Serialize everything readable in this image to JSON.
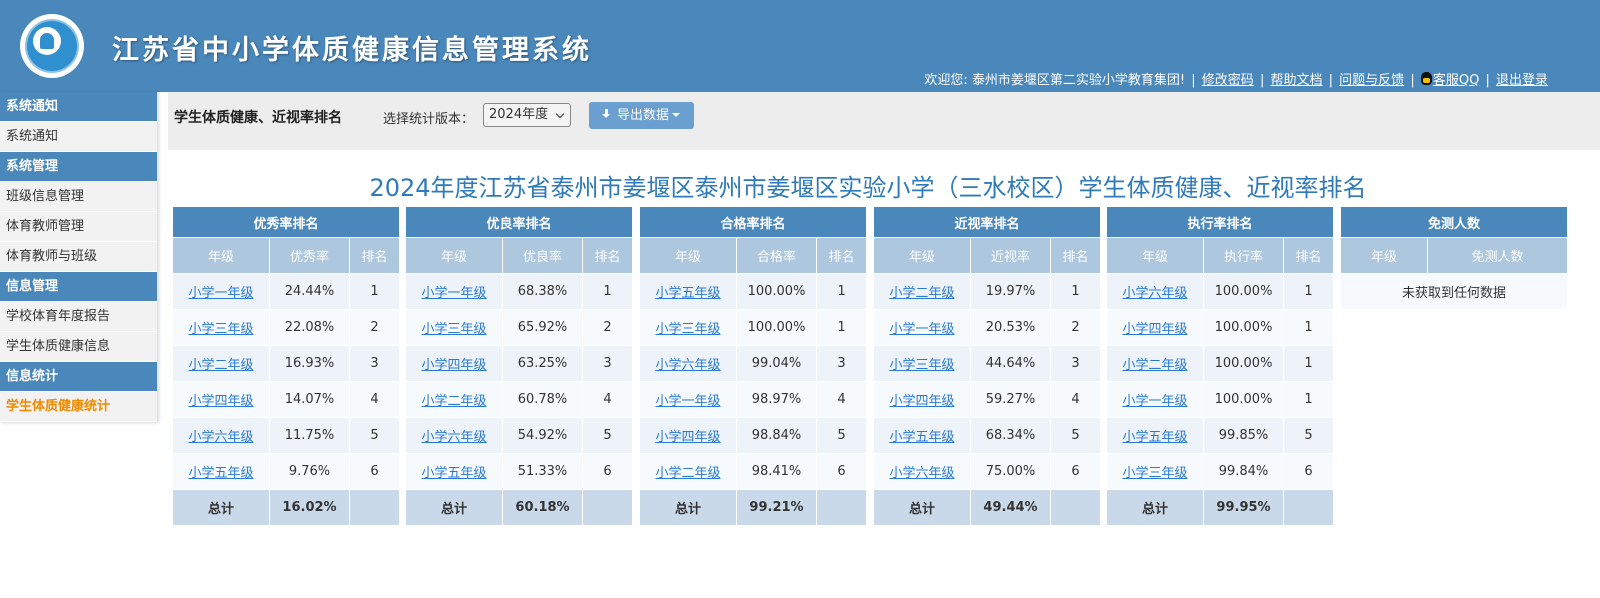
{
  "header": {
    "system_title": "江苏省中小学体质健康信息管理系统",
    "welcome": "欢迎您: 泰州市姜堰区第二实验小学教育集团!",
    "links": {
      "change_password": "修改密码",
      "help": "帮助文档",
      "feedback": "问题与反馈",
      "qq_service": "客服QQ",
      "logout": "退出登录"
    }
  },
  "sidebar": [
    {
      "category": "系统通知",
      "items": [
        {
          "label": "系统通知",
          "active": false
        }
      ]
    },
    {
      "category": "系统管理",
      "items": [
        {
          "label": "班级信息管理",
          "active": false
        },
        {
          "label": "体育教师管理",
          "active": false
        },
        {
          "label": "体育教师与班级",
          "active": false
        }
      ]
    },
    {
      "category": "信息管理",
      "items": [
        {
          "label": "学校体育年度报告",
          "active": false
        },
        {
          "label": "学生体质健康信息",
          "active": false
        }
      ]
    },
    {
      "category": "信息统计",
      "items": [
        {
          "label": "学生体质健康统计",
          "active": true
        }
      ]
    }
  ],
  "toolbar": {
    "title": "学生体质健康、近视率排名",
    "version_label": "选择统计版本：",
    "version_value": "2024年度",
    "export_label": "导出数据"
  },
  "report_title": "2024年度江苏省泰州市姜堰区泰州市姜堰区实验小学（三水校区）学生体质健康、近视率排名",
  "tables": [
    {
      "caption": "优秀率排名",
      "headers": [
        "年级",
        "优秀率",
        "排名"
      ],
      "rows": [
        [
          "小学一年级",
          "24.44%",
          "1"
        ],
        [
          "小学三年级",
          "22.08%",
          "2"
        ],
        [
          "小学二年级",
          "16.93%",
          "3"
        ],
        [
          "小学四年级",
          "14.07%",
          "4"
        ],
        [
          "小学六年级",
          "11.75%",
          "5"
        ],
        [
          "小学五年级",
          "9.76%",
          "6"
        ]
      ],
      "total": [
        "总计",
        "16.02%",
        ""
      ]
    },
    {
      "caption": "优良率排名",
      "headers": [
        "年级",
        "优良率",
        "排名"
      ],
      "rows": [
        [
          "小学一年级",
          "68.38%",
          "1"
        ],
        [
          "小学三年级",
          "65.92%",
          "2"
        ],
        [
          "小学四年级",
          "63.25%",
          "3"
        ],
        [
          "小学二年级",
          "60.78%",
          "4"
        ],
        [
          "小学六年级",
          "54.92%",
          "5"
        ],
        [
          "小学五年级",
          "51.33%",
          "6"
        ]
      ],
      "total": [
        "总计",
        "60.18%",
        ""
      ]
    },
    {
      "caption": "合格率排名",
      "headers": [
        "年级",
        "合格率",
        "排名"
      ],
      "rows": [
        [
          "小学五年级",
          "100.00%",
          "1"
        ],
        [
          "小学三年级",
          "100.00%",
          "1"
        ],
        [
          "小学六年级",
          "99.04%",
          "3"
        ],
        [
          "小学一年级",
          "98.97%",
          "4"
        ],
        [
          "小学四年级",
          "98.84%",
          "5"
        ],
        [
          "小学二年级",
          "98.41%",
          "6"
        ]
      ],
      "total": [
        "总计",
        "99.21%",
        ""
      ]
    },
    {
      "caption": "近视率排名",
      "headers": [
        "年级",
        "近视率",
        "排名"
      ],
      "rows": [
        [
          "小学二年级",
          "19.97%",
          "1"
        ],
        [
          "小学一年级",
          "20.53%",
          "2"
        ],
        [
          "小学三年级",
          "44.64%",
          "3"
        ],
        [
          "小学四年级",
          "59.27%",
          "4"
        ],
        [
          "小学五年级",
          "68.34%",
          "5"
        ],
        [
          "小学六年级",
          "75.00%",
          "6"
        ]
      ],
      "total": [
        "总计",
        "49.44%",
        ""
      ]
    },
    {
      "caption": "执行率排名",
      "headers": [
        "年级",
        "执行率",
        "排名"
      ],
      "rows": [
        [
          "小学六年级",
          "100.00%",
          "1"
        ],
        [
          "小学四年级",
          "100.00%",
          "1"
        ],
        [
          "小学二年级",
          "100.00%",
          "1"
        ],
        [
          "小学一年级",
          "100.00%",
          "1"
        ],
        [
          "小学五年级",
          "99.85%",
          "5"
        ],
        [
          "小学三年级",
          "99.84%",
          "6"
        ]
      ],
      "total": [
        "总计",
        "99.95%",
        ""
      ]
    }
  ],
  "exempt_table": {
    "caption": "免测人数",
    "headers": [
      "年级",
      "免测人数"
    ],
    "empty_text": "未获取到任何数据"
  },
  "colors": {
    "header_bg": "#4a87ba",
    "table_caption_bg": "#4a87ba",
    "table_header_bg": "#adc7df",
    "link": "#2a7ad1",
    "active_menu": "#f08a00",
    "report_title": "#2f7ab8"
  },
  "icons": {
    "logo": "school-health-logo",
    "qq": "qq-penguin-icon",
    "export": "download-icon",
    "select_arrow": "chevron-down-icon",
    "export_dropdown": "caret-down-icon"
  }
}
